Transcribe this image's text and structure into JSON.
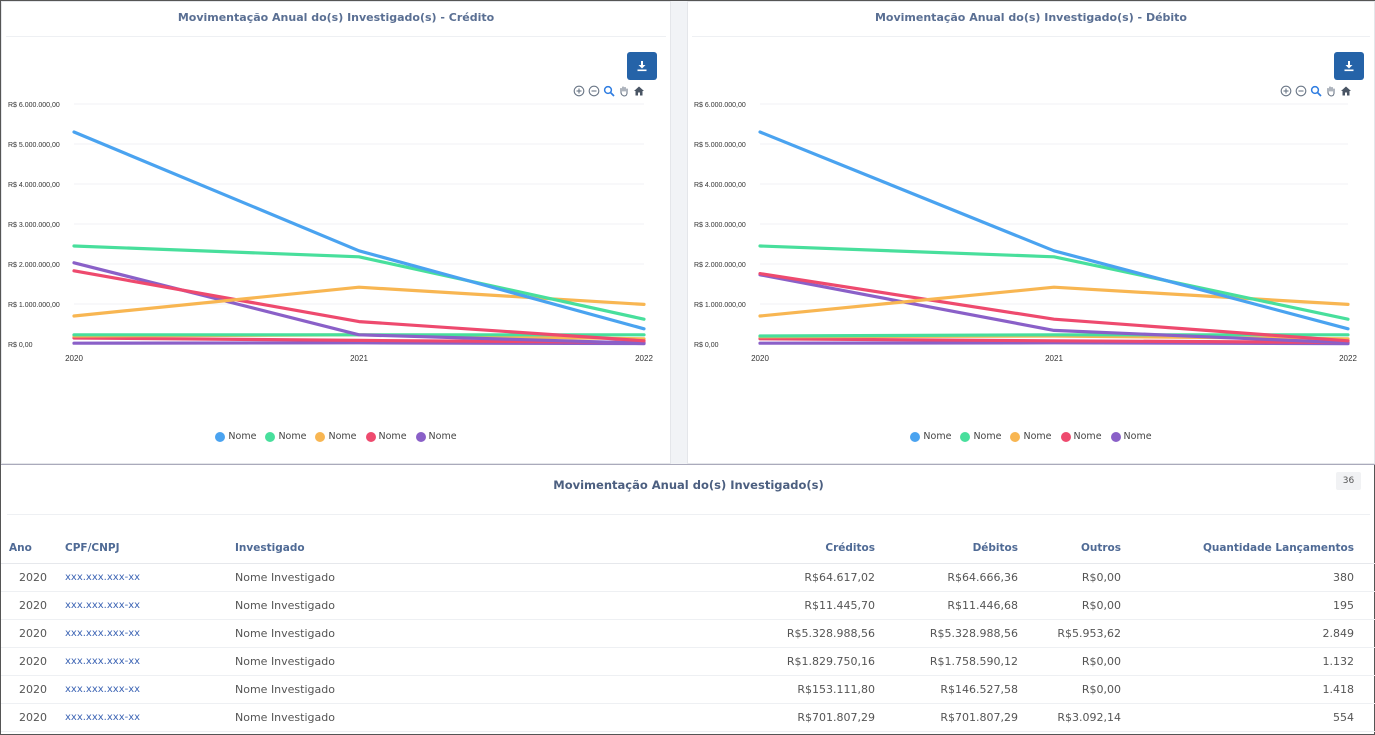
{
  "charts": [
    {
      "panel_title": "Movimentação Anual do(s) Investigado(s) - Crédito",
      "download_icon": "download-icon",
      "tools": [
        "zoom-in-icon",
        "zoom-out-icon",
        "magnifier-icon",
        "pan-hand-icon",
        "home-icon"
      ],
      "chart_data": {
        "type": "line",
        "x": [
          "2020",
          "2021",
          "2022"
        ],
        "y_ticks": [
          "R$ 0,00",
          "R$ 1.000.000,00",
          "R$ 2.000.000,00",
          "R$ 3.000.000,00",
          "R$ 4.000.000,00",
          "R$ 5.000.000,00",
          "R$ 6.000.000,00"
        ],
        "ylim": [
          0,
          6000000
        ],
        "legend_position": "bottom",
        "series": [
          {
            "name": "Nome",
            "color": "#4aa3f0",
            "values": [
              5300000,
              2330000,
              380000
            ]
          },
          {
            "name": "Nome",
            "color": "#48df9c",
            "values": [
              2450000,
              2180000,
              620000
            ]
          },
          {
            "name": "Nome",
            "color": "#f8b652",
            "values": [
              700000,
              1420000,
              990000
            ]
          },
          {
            "name": "Nome",
            "color": "#ee4a6e",
            "values": [
              1830000,
              560000,
              80000
            ]
          },
          {
            "name": "Nome",
            "color": "#8a60c8",
            "values": [
              2030000,
              230000,
              20000
            ]
          },
          {
            "name": "",
            "color": "#48df9c",
            "values": [
              230000,
              230000,
              230000
            ]
          },
          {
            "name": "",
            "color": "#f8b652",
            "values": [
              200000,
              230000,
              130000
            ]
          },
          {
            "name": "",
            "color": "#ee4a6e",
            "values": [
              150000,
              90000,
              40000
            ]
          },
          {
            "name": "",
            "color": "#8a60c8",
            "values": [
              20000,
              30000,
              10000
            ]
          }
        ]
      }
    },
    {
      "panel_title": "Movimentação Anual do(s) Investigado(s) - Débito",
      "download_icon": "download-icon",
      "tools": [
        "zoom-in-icon",
        "zoom-out-icon",
        "magnifier-icon",
        "pan-hand-icon",
        "home-icon"
      ],
      "chart_data": {
        "type": "line",
        "x": [
          "2020",
          "2021",
          "2022"
        ],
        "y_ticks": [
          "R$ 0,00",
          "R$ 1.000.000,00",
          "R$ 2.000.000,00",
          "R$ 3.000.000,00",
          "R$ 4.000.000,00",
          "R$ 5.000.000,00",
          "R$ 6.000.000,00"
        ],
        "ylim": [
          0,
          6000000
        ],
        "legend_position": "bottom",
        "series": [
          {
            "name": "Nome",
            "color": "#4aa3f0",
            "values": [
              5300000,
              2330000,
              380000
            ]
          },
          {
            "name": "Nome",
            "color": "#48df9c",
            "values": [
              2450000,
              2180000,
              620000
            ]
          },
          {
            "name": "Nome",
            "color": "#f8b652",
            "values": [
              700000,
              1420000,
              990000
            ]
          },
          {
            "name": "Nome",
            "color": "#ee4a6e",
            "values": [
              1760000,
              620000,
              80000
            ]
          },
          {
            "name": "Nome",
            "color": "#8a60c8",
            "values": [
              1730000,
              340000,
              30000
            ]
          },
          {
            "name": "",
            "color": "#48df9c",
            "values": [
              200000,
              230000,
              230000
            ]
          },
          {
            "name": "",
            "color": "#f8b652",
            "values": [
              180000,
              200000,
              130000
            ]
          },
          {
            "name": "",
            "color": "#ee4a6e",
            "values": [
              130000,
              80000,
              40000
            ]
          },
          {
            "name": "",
            "color": "#8a60c8",
            "values": [
              20000,
              30000,
              10000
            ]
          }
        ]
      }
    }
  ],
  "table": {
    "title": "Movimentação Anual do(s) Investigado(s)",
    "count_badge": "36",
    "headers": [
      "Ano",
      "CPF/CNPJ",
      "Investigado",
      "Créditos",
      "Débitos",
      "Outros",
      "Quantidade Lançamentos"
    ],
    "rows": [
      [
        "2020",
        "xxx.xxx.xxx-xx",
        "Nome Investigado",
        "R$64.617,02",
        "R$64.666,36",
        "R$0,00",
        "380"
      ],
      [
        "2020",
        "xxx.xxx.xxx-xx",
        "Nome Investigado",
        "R$11.445,70",
        "R$11.446,68",
        "R$0,00",
        "195"
      ],
      [
        "2020",
        "xxx.xxx.xxx-xx",
        "Nome Investigado",
        "R$5.328.988,56",
        "R$5.328.988,56",
        "R$5.953,62",
        "2.849"
      ],
      [
        "2020",
        "xxx.xxx.xxx-xx",
        "Nome Investigado",
        "R$1.829.750,16",
        "R$1.758.590,12",
        "R$0,00",
        "1.132"
      ],
      [
        "2020",
        "xxx.xxx.xxx-xx",
        "Nome Investigado",
        "R$153.111,80",
        "R$146.527,58",
        "R$0,00",
        "1.418"
      ],
      [
        "2020",
        "xxx.xxx.xxx-xx",
        "Nome Investigado",
        "R$701.807,29",
        "R$701.807,29",
        "R$3.092,14",
        "554"
      ]
    ]
  }
}
